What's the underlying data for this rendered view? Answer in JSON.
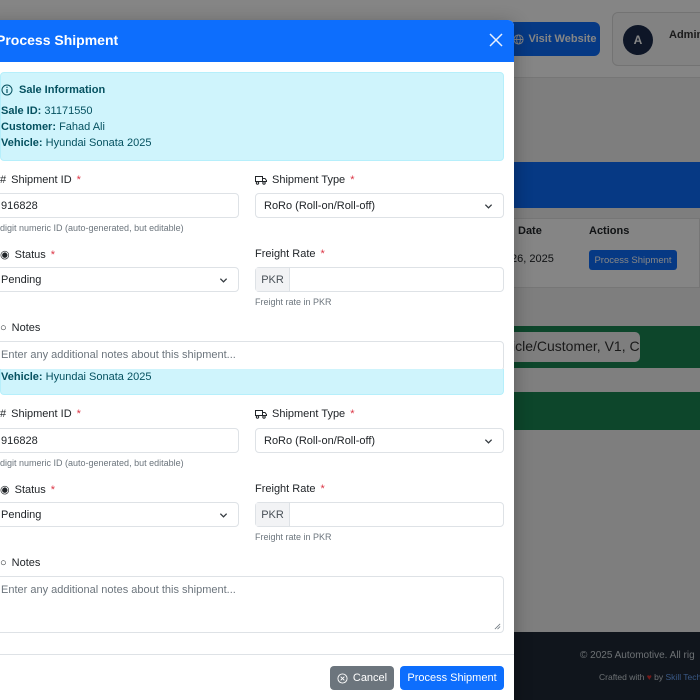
{
  "background": {
    "visit_website": "Visit Website",
    "avatar_initial": "A",
    "admin_label": "Admin",
    "table": {
      "col_date": "Date",
      "col_actions": "Actions",
      "row_date": "26, 2025",
      "row_action": "Process Shipment"
    },
    "search_value": "icle/Customer, V1, C",
    "footer_copyright": "© 2025 Automotive. All rig",
    "footer_crafted": "Crafted with",
    "footer_by": "by",
    "footer_link": "Skill Tech"
  },
  "modal": {
    "title": "Process Shipment",
    "info": {
      "heading": "Sale Information",
      "sale_id_label": "Sale ID:",
      "sale_id": "31171550",
      "customer_label": "Customer:",
      "customer": "Fahad Ali",
      "vehicle_label": "Vehicle:",
      "vehicle": "Hyundai Sonata 2025"
    },
    "form": {
      "shipment_id_label": "Shipment ID",
      "shipment_id_value": "916828",
      "shipment_id_help": "digit numeric ID (auto-generated, but editable)",
      "shipment_type_label": "Shipment Type",
      "shipment_type_value": "RoRo (Roll-on/Roll-off)",
      "status_label": "Status",
      "status_value": "Pending",
      "freight_rate_label": "Freight Rate",
      "freight_currency": "PKR",
      "freight_help": "Freight rate in PKR",
      "notes_label": "Notes",
      "notes_placeholder": "Enter any additional notes about this shipment...",
      "required_mark": "*"
    },
    "footer": {
      "cancel_label": "Cancel",
      "submit_label": "Process Shipment"
    }
  },
  "colors": {
    "primary": "#0d6efd",
    "info_bg": "#cff4fc",
    "secondary": "#6c757d",
    "danger": "#dc3545",
    "success": "#198754"
  }
}
